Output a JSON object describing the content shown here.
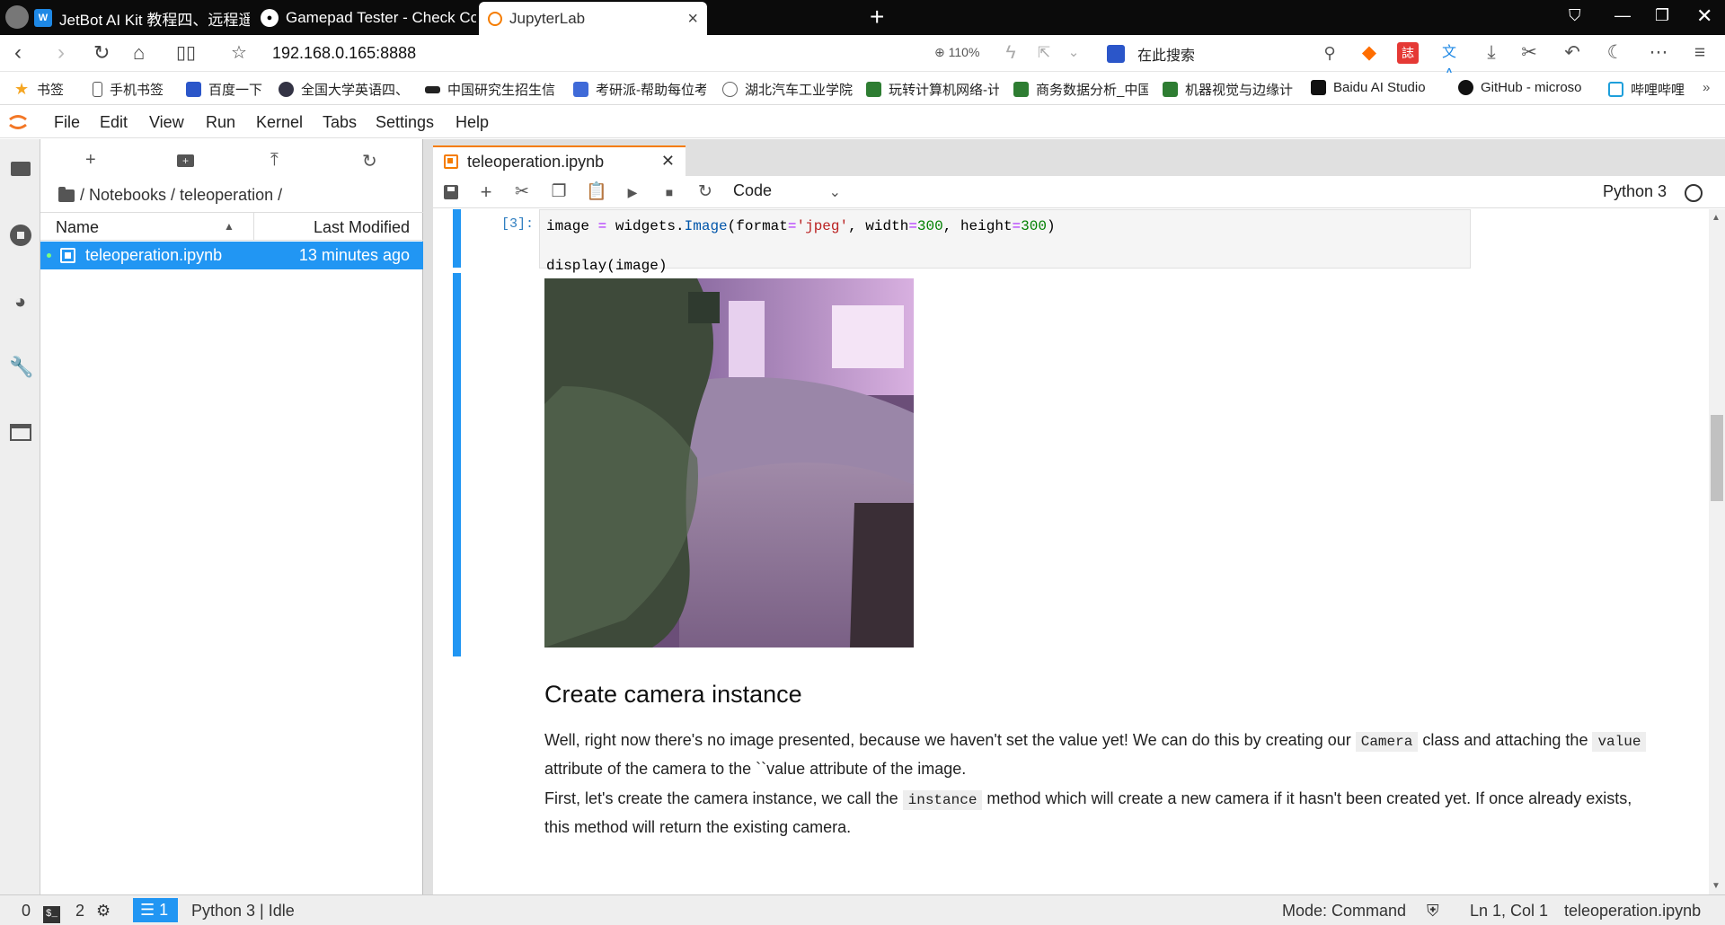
{
  "browser": {
    "tabs": [
      {
        "title": "JetBot AI Kit 教程四、远程遥控 - Wa"
      },
      {
        "title": "Gamepad Tester - Check Controlle"
      },
      {
        "title": "JupyterLab"
      }
    ],
    "url": "192.168.0.165:8888",
    "zoom": "110%",
    "search_placeholder": "在此搜索",
    "bookmarks": [
      "书签",
      "手机书签",
      "百度一下",
      "全国大学英语四、",
      "中国研究生招生信",
      "考研派-帮助每位考",
      "湖北汽车工业学院",
      "玩转计算机网络-计",
      "商务数据分析_中国",
      "机器视觉与边缘计",
      "Baidu AI Studio",
      "GitHub - microso",
      "哔哩哔哩"
    ]
  },
  "jupyter": {
    "menu": [
      "File",
      "Edit",
      "View",
      "Run",
      "Kernel",
      "Tabs",
      "Settings",
      "Help"
    ],
    "filebrowser": {
      "breadcrumb": "/ Notebooks / teleoperation /",
      "col_name": "Name",
      "col_modified": "Last Modified",
      "files": [
        {
          "name": "teleoperation.ipynb",
          "modified": "13 minutes ago"
        }
      ]
    },
    "document_tab": "teleoperation.ipynb",
    "cell_type": "Code",
    "kernel_name": "Python 3",
    "cells": {
      "code_prompt": "[3]:",
      "code_line1": {
        "a": "image ",
        "eq": "=",
        "b": " widgets.",
        "c": "Image",
        "d": "(format",
        "eq2": "=",
        "s": "'jpeg'",
        "e": ", width",
        "eq3": "=",
        "n1": "300",
        "f": ", height",
        "eq4": "=",
        "n2": "300",
        "g": ")"
      },
      "code_line2": "display(image)"
    },
    "markdown": {
      "heading": "Create camera instance",
      "p1_a": "Well, right now there's no image presented, because we haven't set the value yet! We can do this by creating our ",
      "p1_code1": "Camera",
      "p1_b": " class and attaching the ",
      "p1_code2": "value",
      "p1_c": " attribute of the camera to the ``value attribute of the image.",
      "p2_a": "First, let's create the camera instance, we call the ",
      "p2_code": "instance",
      "p2_b": " method which will create a new camera if it hasn't been created yet. If once already exists, this method will return the existing camera."
    },
    "statusbar": {
      "terminals": "0",
      "kernels": "2",
      "cell_count": "1",
      "kernel_status": "Python 3 | Idle",
      "mode": "Mode: Command",
      "position": "Ln 1, Col 1",
      "filename": "teleoperation.ipynb"
    }
  }
}
